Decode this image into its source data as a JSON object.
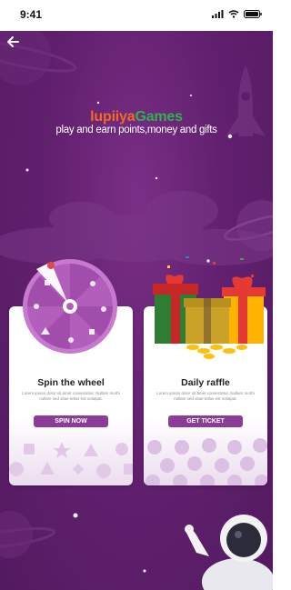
{
  "status": {
    "time": "9:41"
  },
  "header": {
    "title_part1": "lupiiya",
    "title_part2": "Games",
    "subtitle": "play and earn points,money and gifts"
  },
  "cards": [
    {
      "title": "Spin the wheel",
      "description": "Lorem ipsum dolor sit amet consectetur. Nullam morbi nullam sed vitae tellus est volutpat.",
      "button": "SPIN NOW"
    },
    {
      "title": "Daily raffle",
      "description": "Lorem ipsum dolor sit amet consectetur. Nullam morbi nullam sed vitae tellus est volutpat.",
      "button": "GET TICKET"
    }
  ],
  "colors": {
    "background": "#62206f",
    "accent": "#8a3d97",
    "brand_orange": "#f26a21",
    "brand_green": "#2db34a"
  },
  "icons": [
    "back-arrow-icon",
    "signal-icon",
    "wifi-icon",
    "battery-icon"
  ]
}
